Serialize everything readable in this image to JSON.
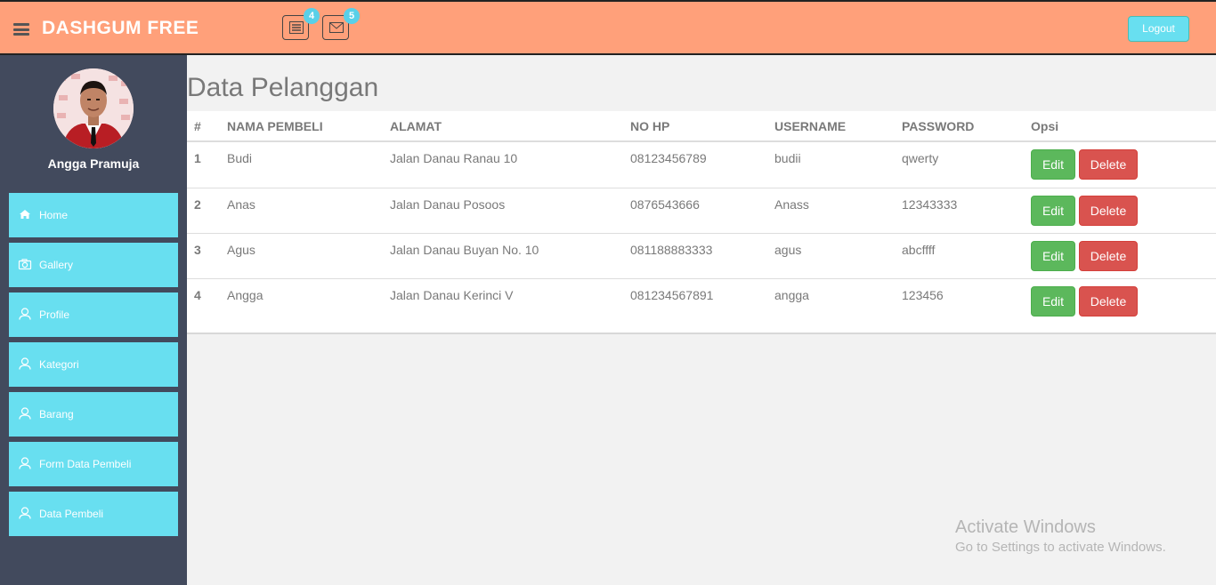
{
  "header": {
    "logo": "DASHGUM FREE",
    "tasks_badge": "4",
    "messages_badge": "5",
    "logout_label": "Logout"
  },
  "sidebar": {
    "username": "Angga Pramuja",
    "items": [
      {
        "label": "Home",
        "icon": "home-icon"
      },
      {
        "label": "Gallery",
        "icon": "camera-icon"
      },
      {
        "label": "Profile",
        "icon": "user-icon"
      },
      {
        "label": "Kategori",
        "icon": "user-icon"
      },
      {
        "label": "Barang",
        "icon": "user-icon"
      },
      {
        "label": "Form Data Pembeli",
        "icon": "user-icon"
      },
      {
        "label": "Data Pembeli",
        "icon": "user-icon"
      }
    ]
  },
  "main": {
    "title": "Data Pelanggan",
    "columns": [
      "#",
      "NAMA PEMBELI",
      "ALAMAT",
      "NO HP",
      "USERNAME",
      "PASSWORD",
      "Opsi"
    ],
    "rows": [
      {
        "no": "1",
        "nama": "Budi",
        "alamat": "Jalan Danau Ranau 10",
        "hp": "08123456789",
        "username": "budii",
        "password": "qwerty"
      },
      {
        "no": "2",
        "nama": "Anas",
        "alamat": "Jalan Danau Posoos",
        "hp": "0876543666",
        "username": "Anass",
        "password": "12343333"
      },
      {
        "no": "3",
        "nama": "Agus",
        "alamat": "Jalan Danau Buyan No. 10",
        "hp": "081188883333",
        "username": "agus",
        "password": "abcffff"
      },
      {
        "no": "4",
        "nama": "Angga",
        "alamat": "Jalan Danau Kerinci V",
        "hp": "081234567891",
        "username": "angga",
        "password": "123456"
      }
    ],
    "edit_label": "Edit",
    "delete_label": "Delete"
  },
  "watermark": {
    "line1": "Activate Windows",
    "line2": "Go to Settings to activate Windows."
  }
}
